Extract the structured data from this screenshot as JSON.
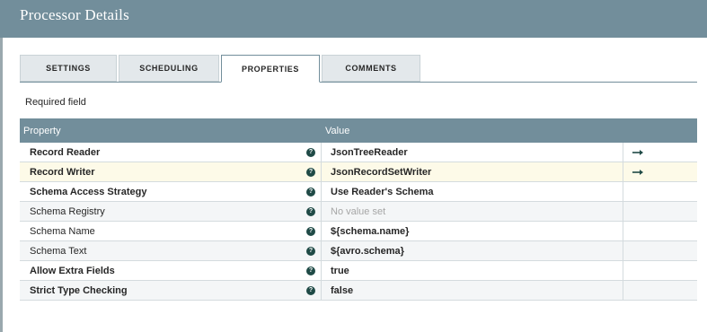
{
  "header": {
    "title": "Processor Details"
  },
  "tabs": [
    {
      "label": "SETTINGS",
      "active": false
    },
    {
      "label": "SCHEDULING",
      "active": false
    },
    {
      "label": "PROPERTIES",
      "active": true
    },
    {
      "label": "COMMENTS",
      "active": false
    }
  ],
  "required_label": "Required field",
  "table": {
    "columns": [
      "Property",
      "Value"
    ],
    "rows": [
      {
        "name": "Record Reader",
        "value": "JsonTreeReader",
        "required": true,
        "placeholder": false,
        "action": "go-to-arrow-icon",
        "selected": false
      },
      {
        "name": "Record Writer",
        "value": "JsonRecordSetWriter",
        "required": true,
        "placeholder": false,
        "action": "go-to-arrow-icon",
        "selected": true
      },
      {
        "name": "Schema Access Strategy",
        "value": "Use Reader's Schema",
        "required": true,
        "placeholder": false,
        "action": "",
        "selected": false
      },
      {
        "name": "Schema Registry",
        "value": "No value set",
        "required": false,
        "placeholder": true,
        "action": "",
        "selected": false
      },
      {
        "name": "Schema Name",
        "value": "${schema.name}",
        "required": false,
        "placeholder": false,
        "action": "",
        "selected": false
      },
      {
        "name": "Schema Text",
        "value": "${avro.schema}",
        "required": false,
        "placeholder": false,
        "action": "",
        "selected": false
      },
      {
        "name": "Allow Extra Fields",
        "value": "true",
        "required": true,
        "placeholder": false,
        "action": "",
        "selected": false
      },
      {
        "name": "Strict Type Checking",
        "value": "false",
        "required": true,
        "placeholder": false,
        "action": "",
        "selected": false
      }
    ]
  },
  "colors": {
    "header": "#728e9b",
    "help_icon": "#1f4a46",
    "selected_row": "#fdfae8"
  }
}
